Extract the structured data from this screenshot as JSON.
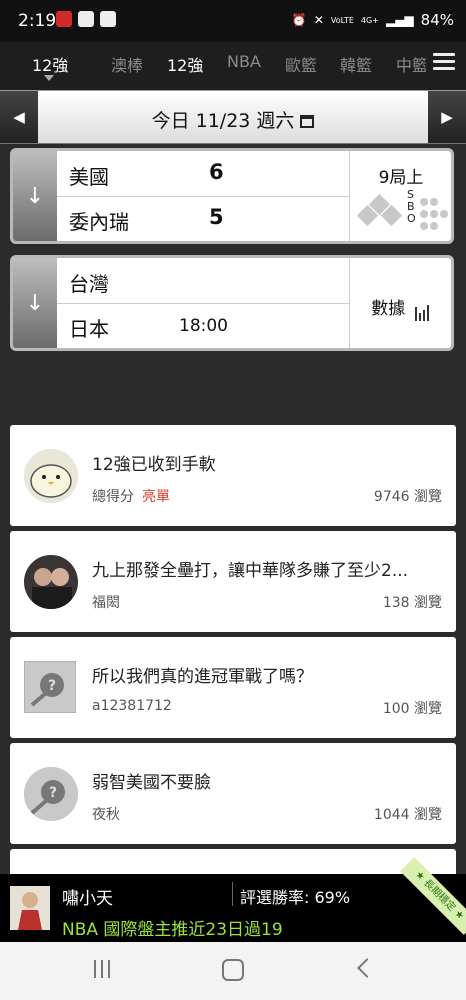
{
  "status_bar": {
    "time": "2:19",
    "battery": "84%",
    "network": "4G+",
    "carrier": "VoLTE"
  },
  "tabs": [
    {
      "label": "12強",
      "active": true
    },
    {
      "label": "澳棒",
      "active": false
    },
    {
      "label": "12強",
      "active": true
    },
    {
      "label": "NBA",
      "active": false
    },
    {
      "label": "歐籃",
      "active": false
    },
    {
      "label": "韓籃",
      "active": false
    },
    {
      "label": "中籃",
      "active": false
    }
  ],
  "date_bar": {
    "label": "今日 11/23 週六"
  },
  "matches": [
    {
      "home": "美國",
      "home_score": "6",
      "away": "委內瑞",
      "away_score": "5",
      "status": "9局上",
      "sbo": [
        "S",
        "B",
        "O"
      ]
    },
    {
      "home": "台灣",
      "away": "日本",
      "time": "18:00",
      "stats_label": "數據"
    }
  ],
  "posts": [
    {
      "title": "12強已收到手軟",
      "author": "總得分",
      "tag": "亮單",
      "views": "9746 瀏覽"
    },
    {
      "title": "九上那發全壘打，讓中華隊多賺了至少2...",
      "author": "福閎",
      "views": "138 瀏覽"
    },
    {
      "title": "所以我們真的進冠軍戰了嗎？",
      "author": "a12381712",
      "views": "100 瀏覽"
    },
    {
      "title": "弱智美國不要臉",
      "author": "夜秋",
      "views": "1044 瀏覽"
    }
  ],
  "footer": {
    "name": "嘯小天",
    "rate": "評選勝率: 69%",
    "promo": "NBA 國際盤主推近23日過19",
    "ribbon": "★ 長期穩定 ★"
  },
  "colors": {
    "accent_red": "#e03b2a",
    "promo_green": "#9be336"
  }
}
